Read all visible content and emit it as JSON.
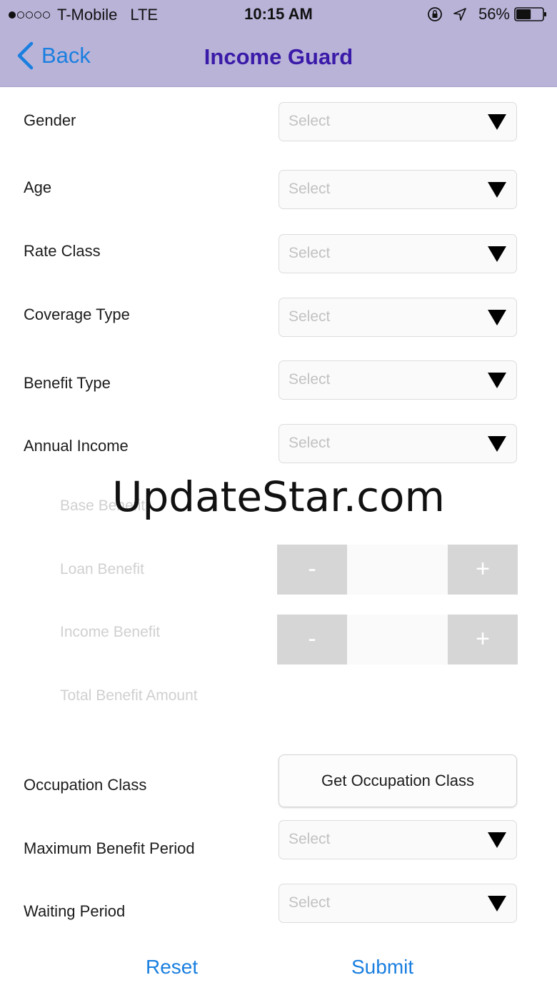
{
  "status_bar": {
    "carrier": "T-Mobile",
    "network": "LTE",
    "time": "10:15 AM",
    "battery": "56%",
    "battery_level": 0.56
  },
  "nav": {
    "back_label": "Back",
    "title": "Income Guard"
  },
  "form": {
    "gender": {
      "label": "Gender",
      "value": "Select"
    },
    "age": {
      "label": "Age",
      "value": "Select"
    },
    "rate_class": {
      "label": "Rate Class",
      "value": "Select"
    },
    "coverage_type": {
      "label": "Coverage Type",
      "value": "Select"
    },
    "benefit_type": {
      "label": "Benefit Type",
      "value": "Select"
    },
    "annual_income": {
      "label": "Annual Income",
      "value": "Select"
    },
    "base_benefit": {
      "label": "Base Benefit"
    },
    "loan_benefit": {
      "label": "Loan Benefit",
      "minus": "-",
      "plus": "+"
    },
    "income_benefit": {
      "label": "Income Benefit",
      "minus": "-",
      "plus": "+"
    },
    "total_benefit": {
      "label": "Total Benefit Amount"
    },
    "occupation_class": {
      "label": "Occupation Class",
      "button_label": "Get Occupation Class"
    },
    "max_benefit_period": {
      "label": "Maximum Benefit Period",
      "value": "Select"
    },
    "waiting_period": {
      "label": "Waiting Period",
      "value": "Select"
    }
  },
  "watermark": "UpdateStar.com",
  "footer": {
    "reset_label": "Reset",
    "submit_label": "Submit"
  },
  "colors": {
    "header_bg": "#b9b3d8",
    "title": "#3a1aa8",
    "accent": "#1a7fe0"
  },
  "icons": [
    "signal-dots-icon",
    "lock-rotation-icon",
    "location-arrow-icon",
    "battery-icon",
    "back-chevron-icon",
    "dropdown-caret-icon"
  ]
}
